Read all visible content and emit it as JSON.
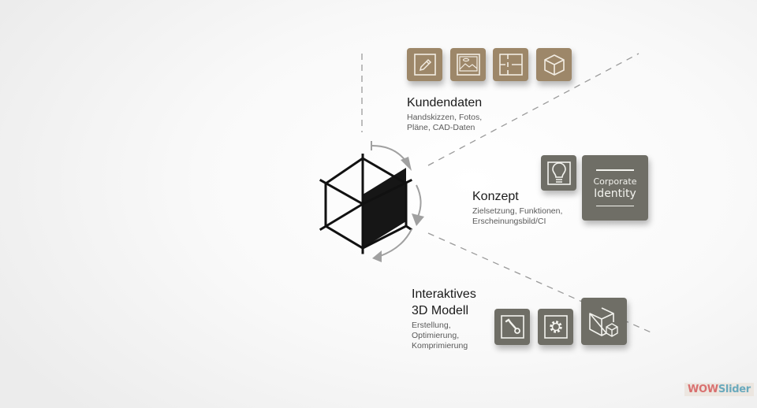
{
  "sections": {
    "kundendaten": {
      "title": "Kundendaten",
      "lines": [
        "Handskizzen, Fotos,",
        "Pläne, CAD-Daten"
      ],
      "icons": [
        "pencil-icon",
        "photo-icon",
        "floor-plan-icon",
        "cube-icon"
      ]
    },
    "konzept": {
      "title": "Konzept",
      "lines": [
        "Zielsetzung, Funktionen,",
        "Erscheinungsbild/CI"
      ],
      "icons": [
        "lightbulb-icon"
      ],
      "ci_badge": {
        "line1": "Corporate",
        "line2": "Identity"
      }
    },
    "modell": {
      "title_line1": "Interaktives",
      "title_line2": "3D Modell",
      "lines": [
        "Erstellung,",
        "Optimierung,",
        "Komprimierung"
      ],
      "icons": [
        "wrench-icon",
        "gear-icon",
        "cube-with-small-cube-icon"
      ]
    }
  },
  "center_icon": "hexagon-cube-icon",
  "cycle_arrows": 3,
  "colors": {
    "brown_tile": "#9d8769",
    "gray_tile": "#6f6e66",
    "arrow": "#a0a0a0",
    "dash_line": "#9a9a9a"
  },
  "watermark": {
    "part1": "WOW",
    "part2": "Slider",
    "color1": "#d9706f",
    "color2": "#6aaabd"
  }
}
